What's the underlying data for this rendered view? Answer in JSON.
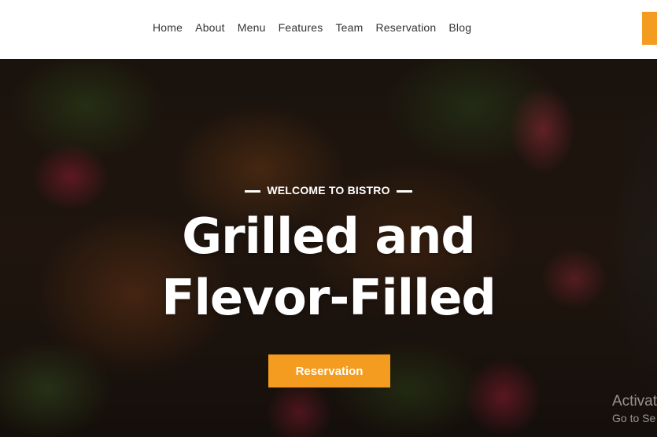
{
  "nav": {
    "items": [
      "Home",
      "About",
      "Menu",
      "Features",
      "Team",
      "Reservation",
      "Blog"
    ]
  },
  "hero": {
    "eyebrow": "WELCOME TO BISTRO",
    "title_line1": "Grilled and",
    "title_line2": "Flevor-Filled",
    "cta_label": "Reservation"
  },
  "watermark": {
    "line1": "Activat",
    "line2": "Go to Se"
  },
  "colors": {
    "accent": "#f39c1f",
    "header_bg": "#ffffff",
    "nav_text": "#333333"
  }
}
